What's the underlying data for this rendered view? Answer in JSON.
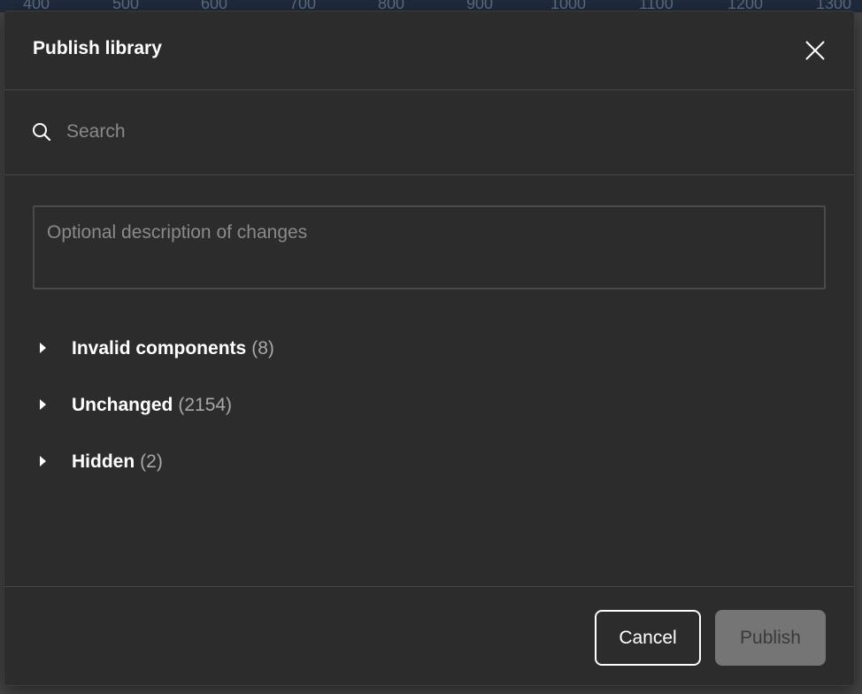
{
  "ruler": {
    "ticks": [
      "400",
      "500",
      "600",
      "700",
      "800",
      "900",
      "1000",
      "1100",
      "1200",
      "1300"
    ]
  },
  "dialog": {
    "title": "Publish library",
    "close_icon": "close-icon",
    "search": {
      "placeholder": "Search",
      "value": "",
      "icon": "search-icon"
    },
    "description": {
      "placeholder": "Optional description of changes",
      "value": ""
    },
    "groups": [
      {
        "label": "Invalid components",
        "count": "(8)",
        "icon": "caret-right-icon"
      },
      {
        "label": "Unchanged",
        "count": "(2154)",
        "icon": "caret-right-icon"
      },
      {
        "label": "Hidden",
        "count": "(2)",
        "icon": "caret-right-icon"
      }
    ],
    "footer": {
      "cancel_label": "Cancel",
      "publish_label": "Publish",
      "publish_enabled": false
    }
  },
  "colors": {
    "dialog_bg": "#2c2c2c",
    "text_primary": "#ffffff",
    "text_muted": "#8a8a8a",
    "publish_disabled_bg": "#757575"
  }
}
